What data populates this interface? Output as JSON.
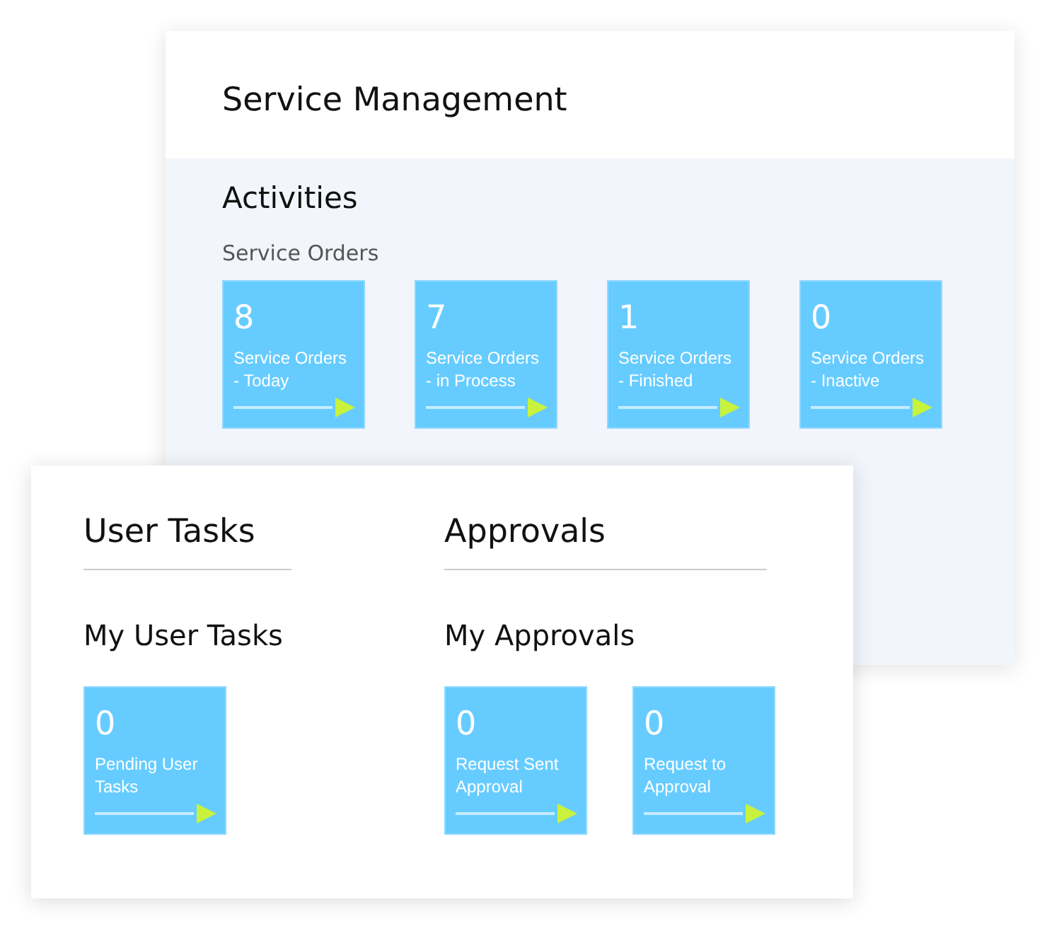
{
  "service_management": {
    "title": "Service Management",
    "section": "Activities",
    "subsection": "Service Orders",
    "tiles": [
      {
        "count": "8",
        "label": "Service Orders - Today"
      },
      {
        "count": "7",
        "label": "Service Orders - in Process"
      },
      {
        "count": "1",
        "label": "Service Orders - Finished"
      },
      {
        "count": "0",
        "label": "Service Orders - Inactive"
      }
    ]
  },
  "panels": [
    {
      "title": "User Tasks",
      "subtitle": "My User Tasks",
      "tiles": [
        {
          "count": "0",
          "label": "Pending User Tasks"
        }
      ]
    },
    {
      "title": "Approvals",
      "subtitle": "My Approvals",
      "tiles": [
        {
          "count": "0",
          "label": "Request Sent Approval"
        },
        {
          "count": "0",
          "label": "Request to Approval"
        }
      ]
    }
  ]
}
